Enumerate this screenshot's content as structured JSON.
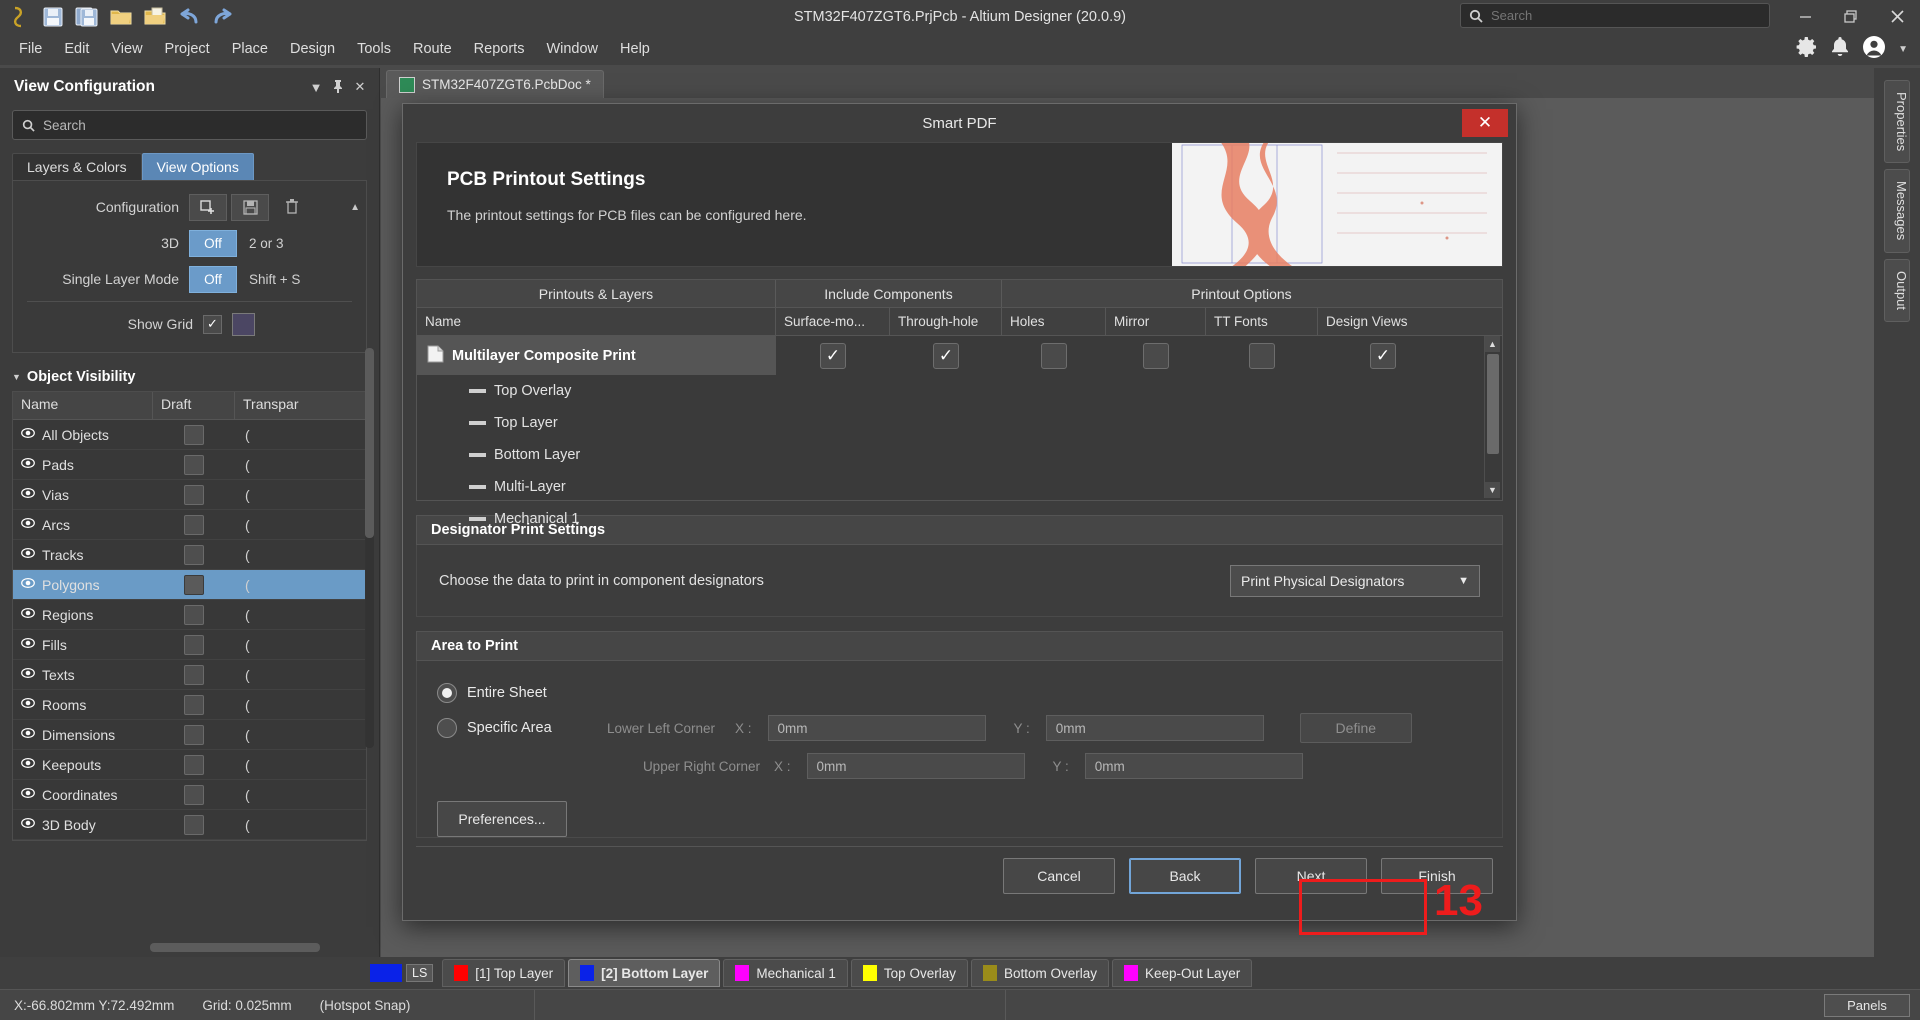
{
  "titlebar": {
    "title": "STM32F407ZGT6.PrjPcb - Altium Designer (20.0.9)",
    "search_placeholder": "Search",
    "icons": [
      "altium-logo",
      "save-icon",
      "save-all-icon",
      "open-folder-icon",
      "open-document-icon",
      "undo-icon",
      "redo-icon"
    ],
    "window_buttons": {
      "minimize": "—",
      "maximize": "❐",
      "close": "✕"
    }
  },
  "menubar": {
    "items": [
      "File",
      "Edit",
      "View",
      "Project",
      "Place",
      "Design",
      "Tools",
      "Route",
      "Reports",
      "Window",
      "Help"
    ],
    "right_icons": [
      "gear-icon",
      "bell-icon",
      "account-icon",
      "chevron-down-icon"
    ]
  },
  "left_panel": {
    "title": "View Configuration",
    "header_icons": [
      "collapse-icon",
      "pin-icon",
      "close-icon"
    ],
    "search_placeholder": "Search",
    "tabs": [
      {
        "label": "Layers & Colors",
        "active": false
      },
      {
        "label": "View Options",
        "active": true
      }
    ],
    "configuration": {
      "label": "Configuration",
      "buttons": [
        "add-config-icon",
        "save-config-icon",
        "delete-config-icon"
      ]
    },
    "three_d": {
      "label": "3D",
      "value": "Off",
      "hint": "2 or 3"
    },
    "single_layer": {
      "label": "Single Layer Mode",
      "value": "Off",
      "hint": "Shift + S"
    },
    "show_grid": {
      "label": "Show Grid",
      "checked": "✓",
      "color": "#4b4663"
    },
    "object_visibility": {
      "title": "Object Visibility",
      "columns": [
        "Name",
        "Draft",
        "Transpar"
      ],
      "rows": [
        {
          "name": "All Objects",
          "selected": false
        },
        {
          "name": "Pads",
          "selected": false
        },
        {
          "name": "Vias",
          "selected": false
        },
        {
          "name": "Arcs",
          "selected": false
        },
        {
          "name": "Tracks",
          "selected": false
        },
        {
          "name": "Polygons",
          "selected": true
        },
        {
          "name": "Regions",
          "selected": false
        },
        {
          "name": "Fills",
          "selected": false
        },
        {
          "name": "Texts",
          "selected": false
        },
        {
          "name": "Rooms",
          "selected": false
        },
        {
          "name": "Dimensions",
          "selected": false
        },
        {
          "name": "Keepouts",
          "selected": false
        },
        {
          "name": "Coordinates",
          "selected": false
        },
        {
          "name": "3D Body",
          "selected": false
        }
      ]
    }
  },
  "document_tab": {
    "label": "STM32F407ZGT6.PcbDoc *"
  },
  "right_strip": {
    "tabs": [
      "Properties",
      "Messages",
      "Output"
    ]
  },
  "dialog": {
    "title": "Smart PDF",
    "close_label": "✕",
    "banner": {
      "heading": "PCB Printout Settings",
      "subtext": "The printout settings for PCB files can be configured here."
    },
    "table": {
      "group_headers": [
        "Printouts & Layers",
        "Include Components",
        "Printout Options"
      ],
      "columns": [
        "Name",
        "Surface-mo...",
        "Through-hole",
        "Holes",
        "Mirror",
        "TT Fonts",
        "Design Views"
      ],
      "printout": {
        "name": "Multilayer Composite Print",
        "surface_mount": true,
        "through_hole": true,
        "holes": false,
        "mirror": false,
        "tt_fonts": false,
        "design_views": true,
        "check_glyph": "✓"
      },
      "layers": [
        "Top Overlay",
        "Top Layer",
        "Bottom Layer",
        "Multi-Layer",
        "Mechanical 1"
      ]
    },
    "designator_settings": {
      "title": "Designator Print Settings",
      "label": "Choose the data to print in component designators",
      "value": "Print Physical Designators",
      "caret": "▼"
    },
    "area_to_print": {
      "title": "Area to Print",
      "entire_sheet": {
        "label": "Entire Sheet",
        "selected": true
      },
      "specific_area": {
        "label": "Specific Area",
        "selected": false
      },
      "lower_left_label": "Lower Left Corner",
      "upper_right_label": "Upper Right Corner",
      "x_label": "X :",
      "y_label": "Y :",
      "lower_left_x": "0mm",
      "lower_left_y": "0mm",
      "upper_right_x": "0mm",
      "upper_right_y": "0mm",
      "define_button": "Define"
    },
    "preferences_button": "Preferences...",
    "footer_buttons": {
      "cancel": "Cancel",
      "back": "Back",
      "next": "Next",
      "finish": "Finish"
    },
    "annotation": {
      "step_number": "13",
      "highlight_color": "#ee1c1c",
      "target": "next-button"
    }
  },
  "layer_tabs": {
    "ls_label": "LS",
    "ls_color": "#0a22e8",
    "tabs": [
      {
        "label": "[1] Top Layer",
        "color": "#ff0000",
        "active": false
      },
      {
        "label": "[2] Bottom Layer",
        "color": "#0a22e8",
        "active": true
      },
      {
        "label": "Mechanical 1",
        "color": "#ff00ff",
        "active": false
      },
      {
        "label": "Top Overlay",
        "color": "#ffff00",
        "active": false
      },
      {
        "label": "Bottom Overlay",
        "color": "#9a8c1a",
        "active": false
      },
      {
        "label": "Keep-Out Layer",
        "color": "#ff00ff",
        "active": false
      }
    ]
  },
  "statusbar": {
    "coordinates": "X:-66.802mm Y:72.492mm",
    "grid": "Grid: 0.025mm",
    "snap": "(Hotspot Snap)",
    "panels_button": "Panels"
  }
}
